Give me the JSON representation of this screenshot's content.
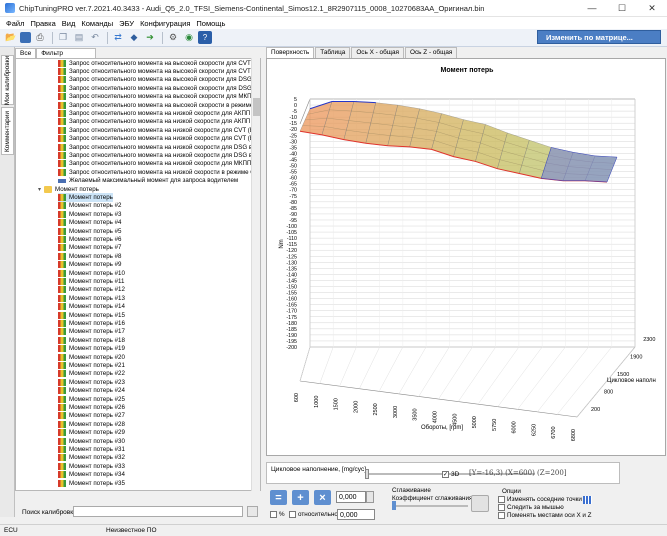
{
  "window": {
    "title": "ChipTuningPRO ver.7.2021.40.3433 - Audi_Q5_2.0_TFSI_Siemens-Continental_Simos12.1_8R2907115_0008_10270683AA_Оригинал.bin",
    "minimize": "—",
    "maximize": "☐",
    "close": "✕"
  },
  "menu": [
    "Файл",
    "Правка",
    "Вид",
    "Команды",
    "ЭБУ",
    "Конфигурация",
    "Помощь"
  ],
  "toolbar": {
    "icons": [
      "open-icon",
      "save-icon",
      "print-icon",
      "copy-icon",
      "paste-icon",
      "undo-icon",
      "compare-icon",
      "diamond-icon",
      "arrow-icon",
      "checksum-icon",
      "settings-icon",
      "help-icon"
    ],
    "matrix_select": "Изменить по матрице..."
  },
  "side_tabs": [
    "Мои калибровки",
    "Комментарии"
  ],
  "tree_tabs": [
    "Все",
    "Фильтр"
  ],
  "tree": {
    "items_top": [
      "Запрос относительного момента на высокой скорости для CVT (Вар",
      "Запрос относительного момента на высокой скорости для CVT (Вар",
      "Запрос относительного момента на высокой скорости для DSG в ре",
      "Запрос относительного момента на высокой скорости для DSG в ре",
      "Запрос относительного момента на высокой скорости для МКПП",
      "Запрос относительного момента на высокой скорости в режиме Off",
      "Запрос относительного момента на низкой скорости для АКПП в ре",
      "Запрос относительного момента на низкой скорости для АКПП в ре",
      "Запрос относительного момента на низкой скорости для CVT (Вари",
      "Запрос относительного момента на низкой скорости для CVT (Вари",
      "Запрос относительного момента на низкой скорости для DSG в реж",
      "Запрос относительного момента на низкой скорости для DSG в реж",
      "Запрос относительного момента на низкой скорости для МКПП",
      "Запрос относительного момента на низкой скорости в режиме Off-"
    ],
    "item_2d": "Желаемый максимальный момент для запроса водителем",
    "folder": "Момент потерь",
    "children": [
      "Момент потерь",
      "Момент потерь #2",
      "Момент потерь #3",
      "Момент потерь #4",
      "Момент потерь #5",
      "Момент потерь #6",
      "Момент потерь #7",
      "Момент потерь #8",
      "Момент потерь #9",
      "Момент потерь #10",
      "Момент потерь #11",
      "Момент потерь #12",
      "Момент потерь #13",
      "Момент потерь #14",
      "Момент потерь #15",
      "Момент потерь #16",
      "Момент потерь #17",
      "Момент потерь #18",
      "Момент потерь #19",
      "Момент потерь #20",
      "Момент потерь #21",
      "Момент потерь #22",
      "Момент потерь #23",
      "Момент потерь #24",
      "Момент потерь #25",
      "Момент потерь #26",
      "Момент потерь #27",
      "Момент потерь #28",
      "Момент потерь #29",
      "Момент потерь #30",
      "Момент потерь #31",
      "Момент потерь #32",
      "Момент потерь #33",
      "Момент потерь #34",
      "Момент потерь #35"
    ],
    "selected": "Момент потерь"
  },
  "search": {
    "label": "Поиск калибровки",
    "value": ""
  },
  "graph_tabs": [
    "Поверхность",
    "Таблица",
    "Ось X - общая",
    "Ось Z - общая"
  ],
  "chart_data": {
    "type": "surface",
    "title": "Момент потерь",
    "ylabel": "Nm",
    "xlabel": "Обороты, [rpm]",
    "zlabel": "Цикловое наполн",
    "y_ticks": [
      5,
      0,
      -5,
      -10,
      -15,
      -20,
      -25,
      -30,
      -35,
      -40,
      -45,
      -50,
      -55,
      -60,
      -65,
      -70,
      -75,
      -80,
      -85,
      -90,
      -95,
      -100,
      -105,
      -110,
      -115,
      -120,
      -125,
      -130,
      -135,
      -140,
      -145,
      -150,
      -155,
      -160,
      -165,
      -170,
      -175,
      -180,
      -185,
      -190,
      -195,
      -200
    ],
    "x_ticks": [
      "600",
      "1000",
      "1500",
      "2000",
      "2500",
      "3000",
      "3500",
      "4000",
      "4500",
      "5000",
      "5750",
      "6000",
      "6250",
      "6700",
      "6800"
    ],
    "z_ticks": [
      "200",
      "800",
      "1500",
      "1900",
      "2300"
    ],
    "ylim": [
      -200,
      5
    ],
    "surface_min_y": [
      -15,
      -18,
      -22,
      -25,
      -27,
      -28,
      -30,
      -36,
      -40,
      -46,
      -50,
      -54,
      -56,
      -56,
      -57
    ],
    "surface_max_y": [
      -8,
      -2,
      -2,
      -3,
      -5,
      -8,
      -12,
      -17,
      -21,
      -28,
      -34,
      -40,
      -44,
      -47,
      -48
    ]
  },
  "slider": {
    "label": "Цикловое наполнение, [mg/cyc]",
    "checkbox_3d": "3D",
    "readout": "[Y=-16,3) (X=600) (Z=200]"
  },
  "controls": {
    "value1": "0,000",
    "value2": "0,000",
    "percent_label": "%",
    "relative_label": "относительно",
    "smoothing_title": "Сглаживание",
    "smoothing_coef": "Коэффициент сглаживания",
    "options_title": "Опции",
    "opt1": "Изменять соседние точки",
    "opt2": "Следить за мышью",
    "opt3": "Поменять местами оси X и Z"
  },
  "status": {
    "ecu": "ECU",
    "unknown": "Неизвестное ПО"
  },
  "colors": {
    "accent": "#4b7ec4",
    "surface_red": "#e0342c",
    "surface_blue": "#2636c8"
  }
}
